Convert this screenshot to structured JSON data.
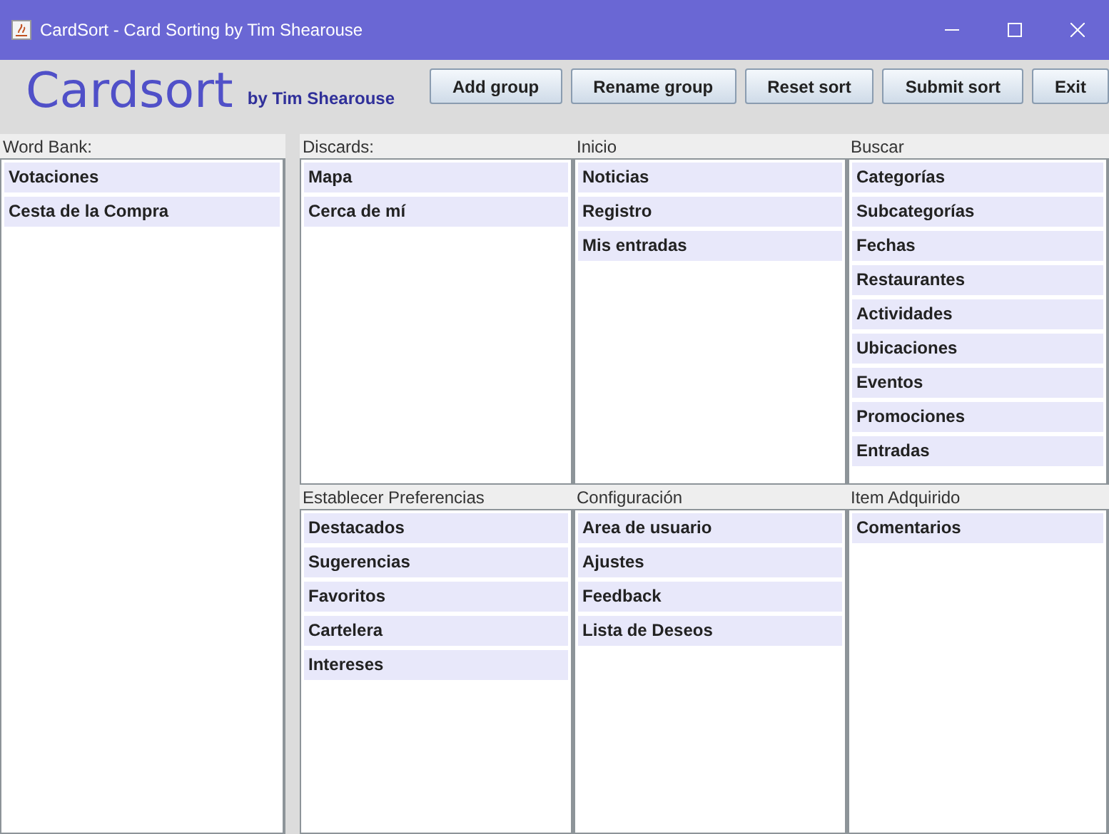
{
  "window": {
    "title": "CardSort - Card Sorting by Tim Shearouse"
  },
  "header": {
    "app_name": "Cardsort",
    "byline": "by Tim Shearouse"
  },
  "buttons": [
    "Add group",
    "Rename group",
    "Reset sort",
    "Submit sort",
    "Exit"
  ],
  "word_bank": {
    "label": "Word Bank:",
    "cards": [
      "Votaciones",
      "Cesta de la Compra"
    ]
  },
  "groups": [
    {
      "label": "Discards:",
      "cards": [
        "Mapa",
        "Cerca de mí"
      ]
    },
    {
      "label": "Inicio",
      "cards": [
        "Noticias",
        "Registro",
        "Mis entradas"
      ]
    },
    {
      "label": "Buscar",
      "cards": [
        "Categorías",
        "Subcategorías",
        "Fechas",
        "Restaurantes",
        "Actividades",
        "Ubicaciones",
        "Eventos",
        "Promociones",
        "Entradas"
      ]
    },
    {
      "label": "Establecer Preferencias",
      "cards": [
        "Destacados",
        "Sugerencias",
        "Favoritos",
        "Cartelera",
        "Intereses"
      ]
    },
    {
      "label": "Configuración",
      "cards": [
        "Area de usuario",
        "Ajustes",
        "Feedback",
        "Lista de Deseos"
      ]
    },
    {
      "label": "Item Adquirido",
      "cards": [
        "Comentarios"
      ]
    }
  ]
}
